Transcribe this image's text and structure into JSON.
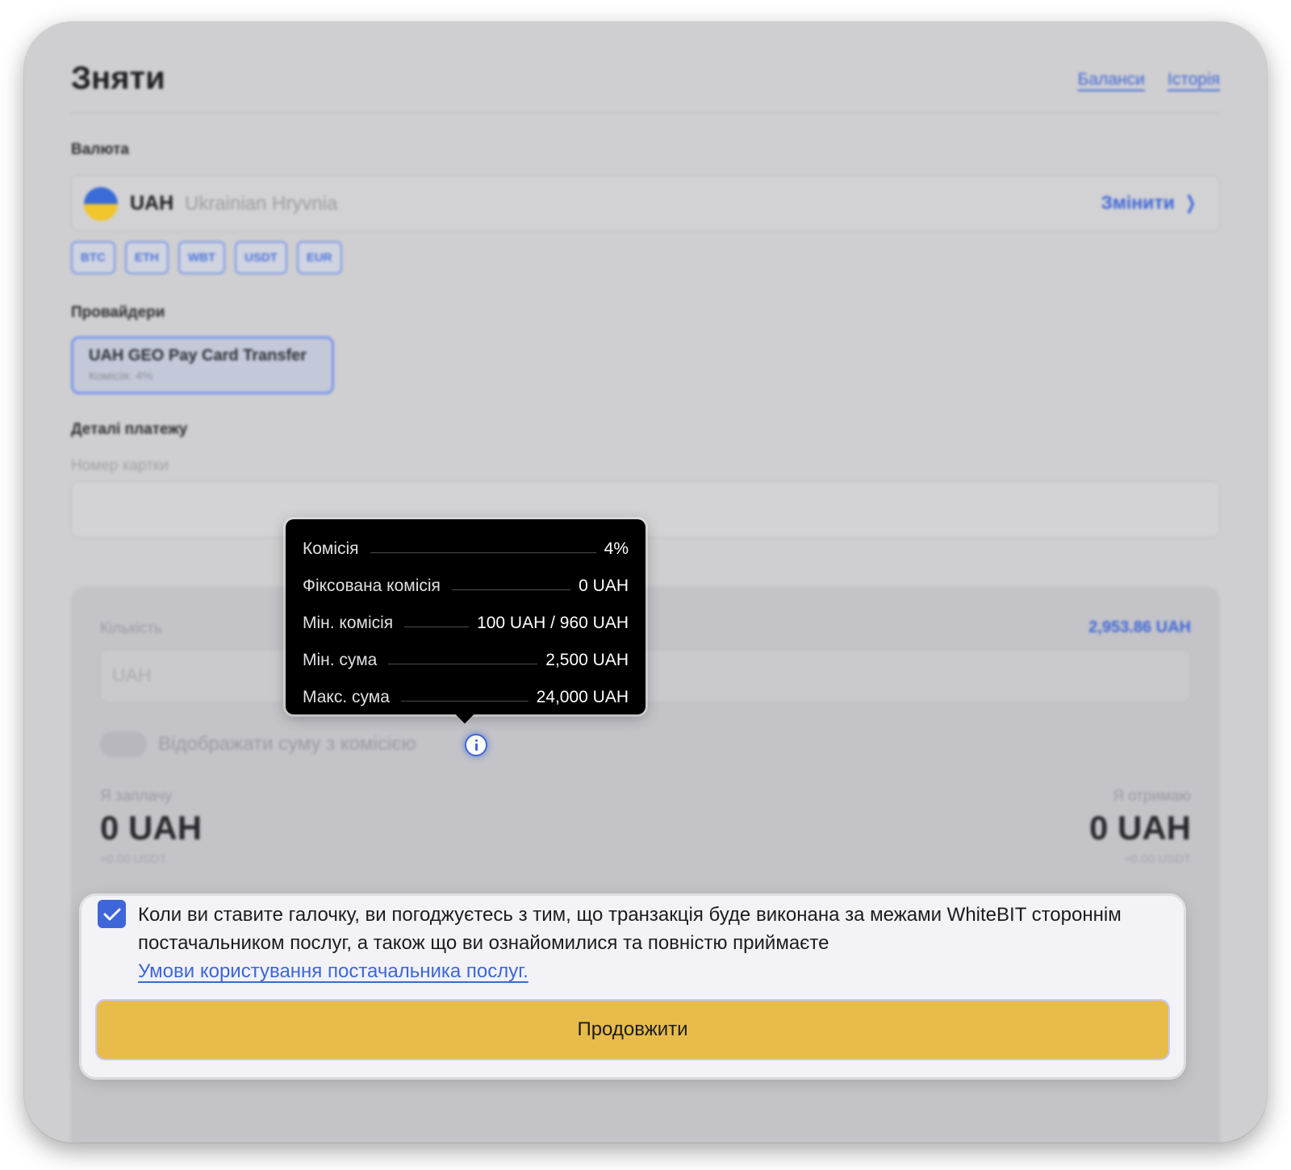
{
  "page": {
    "title": "Зняти",
    "links": {
      "balances": "Баланси",
      "history": "Історія"
    }
  },
  "currency": {
    "label": "Валюта",
    "code": "UAH",
    "name": "Ukrainian Hryvnia",
    "change_label": "Змінити",
    "quick_chips": [
      "BTC",
      "ETH",
      "WBT",
      "USDT",
      "EUR"
    ]
  },
  "providers": {
    "label": "Провайдери",
    "selected": {
      "name": "UAH GEO Pay Card Transfer",
      "fee": "Комісія: 4%"
    }
  },
  "payment_details": {
    "label": "Деталі платежу",
    "card_number_label": "Номер картки",
    "card_number_value": ""
  },
  "amount": {
    "label": "Кількість",
    "balance": "2,953.86 UAH",
    "placeholder": "UAH",
    "toggle_label": "Відображати суму з комісією",
    "pay_label": "Я заплачу",
    "pay_amount": "0 UAH",
    "pay_usdt": "≈0.00 USDT",
    "receive_label": "Я отримаю",
    "receive_amount": "0 UAH",
    "receive_usdt": "≈0.00 USDT"
  },
  "tooltip": {
    "rows": [
      {
        "label": "Комісія",
        "value": "4%"
      },
      {
        "label": "Фіксована комісія",
        "value": "0 UAH"
      },
      {
        "label": "Мін. комісія",
        "value": "100 UAH / 960 UAH"
      },
      {
        "label": "Мін. сума",
        "value": "2,500 UAH"
      },
      {
        "label": "Макс. сума",
        "value": "24,000 UAH"
      }
    ]
  },
  "consent": {
    "checked": true,
    "text": "Коли ви ставите галочку, ви погоджуєтесь з тим, що транзакція буде виконана за межами WhiteBIT стороннім постачальником послуг, а також що ви ознайомилися та повністю приймаєте",
    "link_text": "Умови користування постачальника послуг."
  },
  "actions": {
    "continue_label": "Продовжити"
  },
  "colors": {
    "accent": "#3e66d8",
    "button": "#e8bc4b",
    "tooltip_bg": "#000000"
  }
}
